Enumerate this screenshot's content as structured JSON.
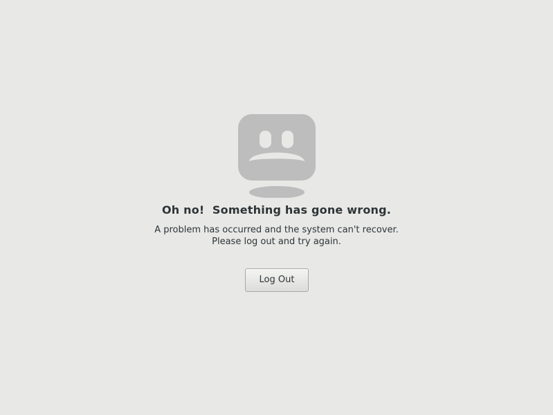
{
  "error": {
    "icon": "sad-face-monitor-icon",
    "title": "Oh no!  Something has gone wrong.",
    "message_line1": "A problem has occurred and the system can't recover.",
    "message_line2": "Please log out and try again."
  },
  "actions": {
    "logout_label": "Log Out"
  },
  "colors": {
    "background": "#e8e8e7",
    "icon": "#bdbdbd",
    "text": "#2e3436"
  }
}
